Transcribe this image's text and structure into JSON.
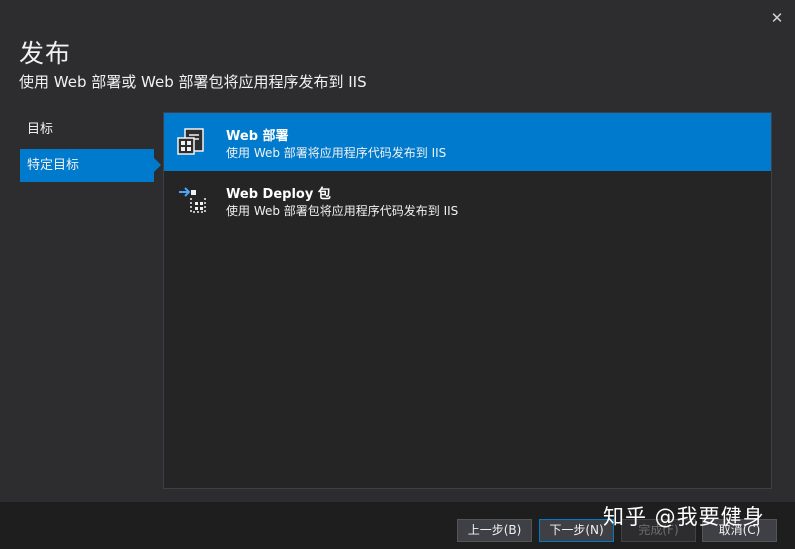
{
  "dialog": {
    "title": "发布",
    "subtitle": "使用 Web 部署或 Web 部署包将应用程序发布到 IIS",
    "close_icon": "close-icon"
  },
  "nav": {
    "items": [
      {
        "label": "目标",
        "selected": false
      },
      {
        "label": "特定目标",
        "selected": true
      }
    ]
  },
  "options": [
    {
      "name": "Web 部署",
      "desc": "使用 Web 部署将应用程序代码发布到 IIS",
      "icon": "web-deploy-icon",
      "selected": true
    },
    {
      "name": "Web Deploy 包",
      "desc": "使用 Web 部署包将应用程序代码发布到 IIS",
      "icon": "web-deploy-package-icon",
      "selected": false
    }
  ],
  "footer": {
    "back_label": "上一步(B)",
    "next_label": "下一步(N)",
    "finish_label": "完成(F)",
    "cancel_label": "取消(C)"
  },
  "watermark": "知乎 @我要健身",
  "colors": {
    "accent": "#007acc",
    "background": "#2d2d30",
    "panel": "#252526",
    "footer": "#1e1e1e"
  }
}
